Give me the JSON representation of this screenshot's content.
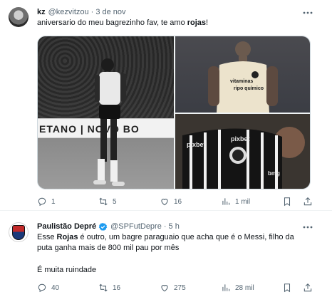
{
  "tweets": [
    {
      "author": {
        "name": "kz",
        "handle": "@kezvitzou",
        "verified": false
      },
      "separator": "·",
      "time": "3 de nov",
      "text": {
        "before": "aniversario do meu bagrezinho fav, te amo ",
        "bold": "rojas",
        "after": "!"
      },
      "media": {
        "banner_text": "ETANO | NOVO BO",
        "jersey_texts": [
          "vitaminas",
          "ripo químico"
        ],
        "jersey_texts_dark": [
          "pixbet",
          "pixbet",
          "bmg"
        ]
      },
      "stats": {
        "replies": "1",
        "retweets": "5",
        "likes": "16",
        "views": "1 mil"
      }
    },
    {
      "author": {
        "name": "Paulistão Depré",
        "handle": "@SPFutDepre",
        "verified": true
      },
      "separator": "·",
      "time": "5 h",
      "text_line1": {
        "before": "Esse ",
        "bold": "Rojas",
        "after": " é outro, um bagre paraguaio que acha que é o Messi, filho da"
      },
      "text_line2": "puta ganha mais de 800 mil pau por mês",
      "text_line3": "É muita ruindade",
      "stats": {
        "replies": "40",
        "retweets": "16",
        "likes": "275",
        "views": "28 mil"
      }
    }
  ],
  "icons": {
    "more": "more-horizontal-icon",
    "reply": "reply-icon",
    "retweet": "retweet-icon",
    "like": "heart-icon",
    "views": "views-icon",
    "bookmark": "bookmark-icon",
    "share": "share-icon",
    "verified": "verified-badge-icon"
  },
  "colors": {
    "text": "#0f1419",
    "muted": "#536471",
    "verified": "#1d9bf0",
    "border": "#cfd9de"
  }
}
